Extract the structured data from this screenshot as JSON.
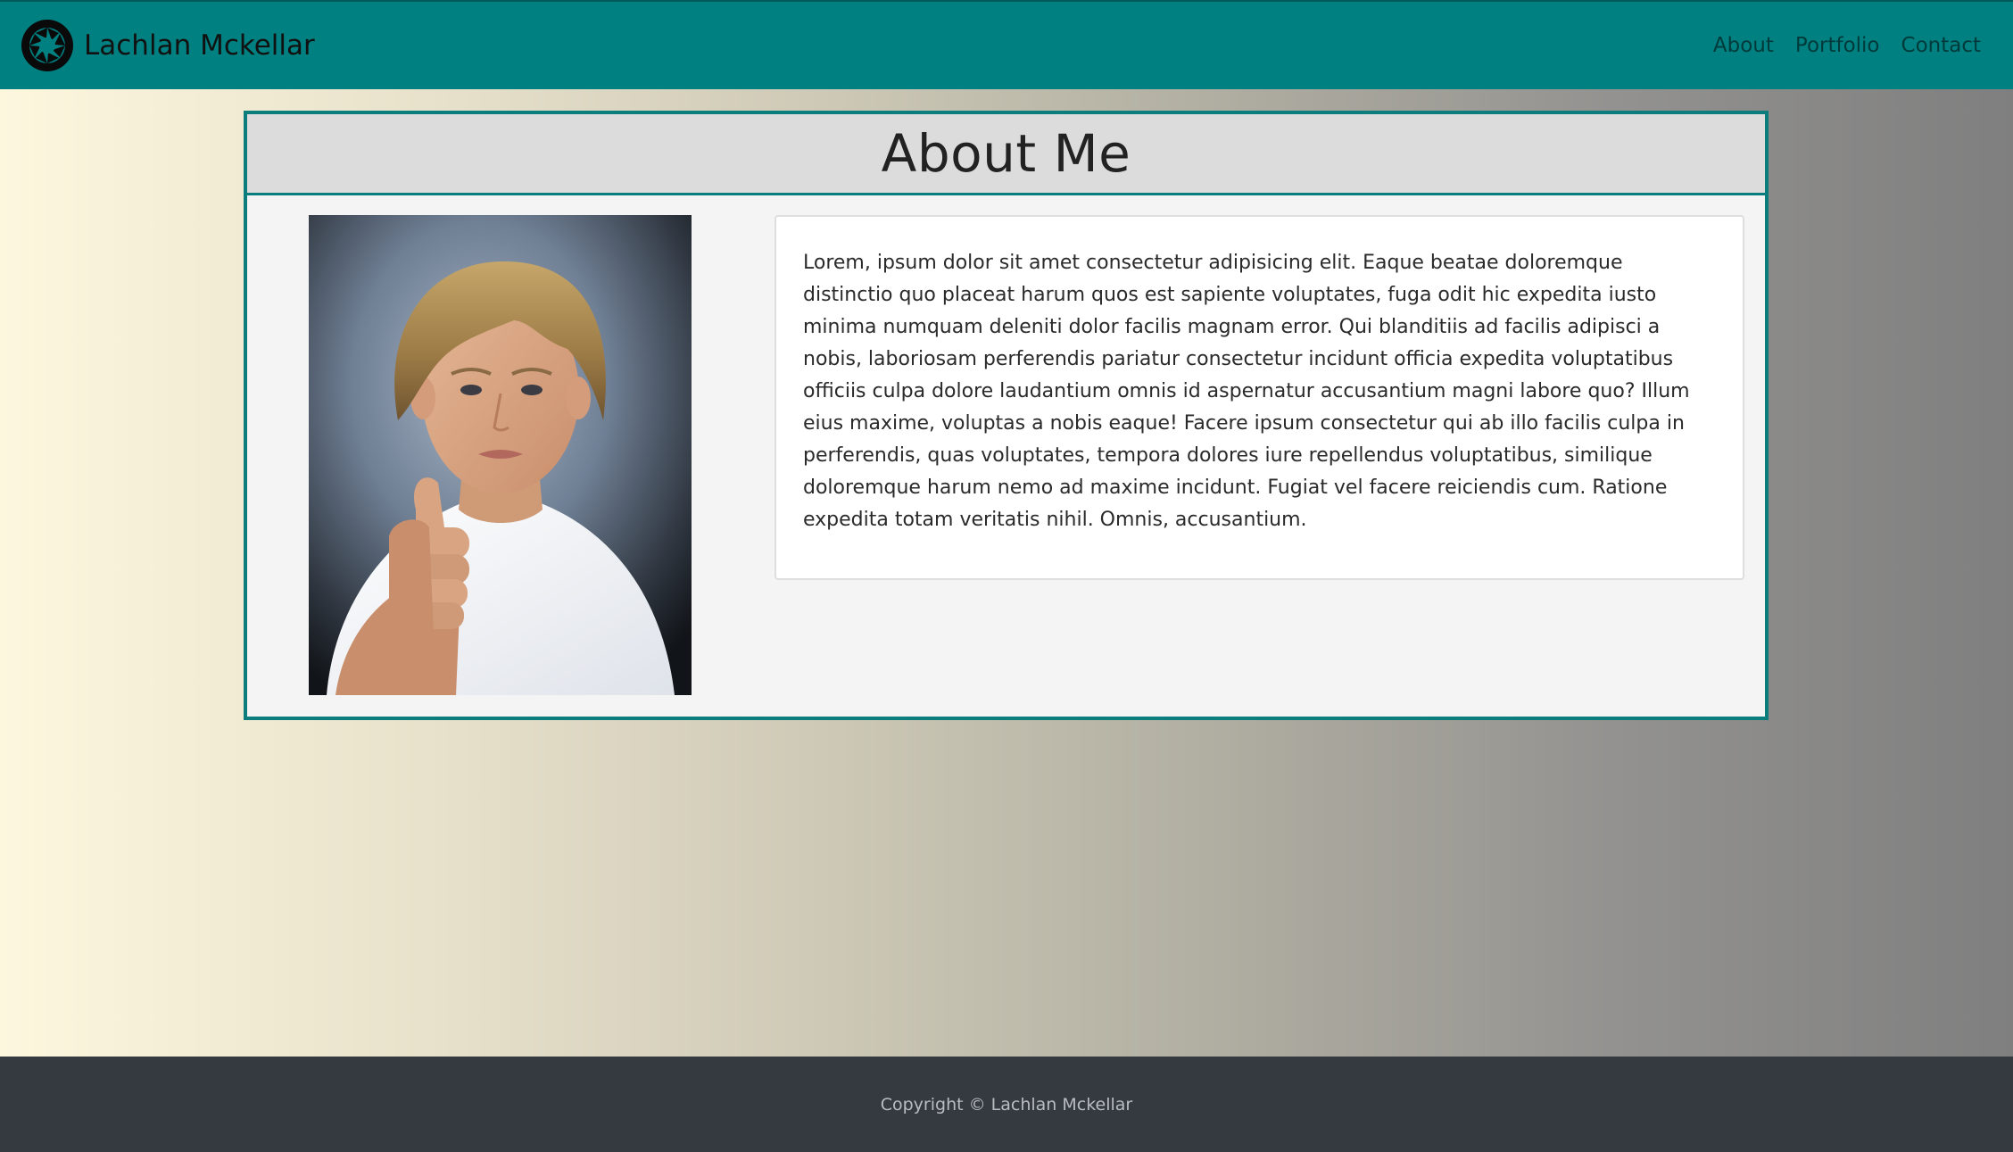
{
  "navbar": {
    "brand_name": "Lachlan Mckellar",
    "logo_icon": "aperture-icon",
    "links": [
      {
        "label": "About"
      },
      {
        "label": "Portfolio"
      },
      {
        "label": "Contact"
      }
    ]
  },
  "about": {
    "title": "About Me",
    "photo": "portrait of a boy giving a thumbs up",
    "bio": "Lorem, ipsum dolor sit amet consectetur adipisicing elit. Eaque beatae doloremque distinctio quo placeat harum quos est sapiente voluptates, fuga odit hic expedita iusto minima numquam deleniti dolor facilis magnam error. Qui blanditiis ad facilis adipisci a nobis, laboriosam perferendis pariatur consectetur incidunt officia expedita voluptatibus officiis culpa dolore laudantium omnis id aspernatur accusantium magni labore quo? Illum eius maxime, voluptas a nobis eaque! Facere ipsum consectetur qui ab illo facilis culpa in perferendis, quas voluptates, tempora dolores iure repellendus voluptatibus, similique doloremque harum nemo ad maxime incidunt. Fugiat vel facere reiciendis cum. Ratione expedita totam veritatis nihil. Omnis, accusantium."
  },
  "footer": {
    "copyright": "Copyright © Lachlan Mckellar"
  },
  "colors": {
    "navbar": "#008080",
    "card_border": "#0c7d7d",
    "footer": "#343a40"
  }
}
